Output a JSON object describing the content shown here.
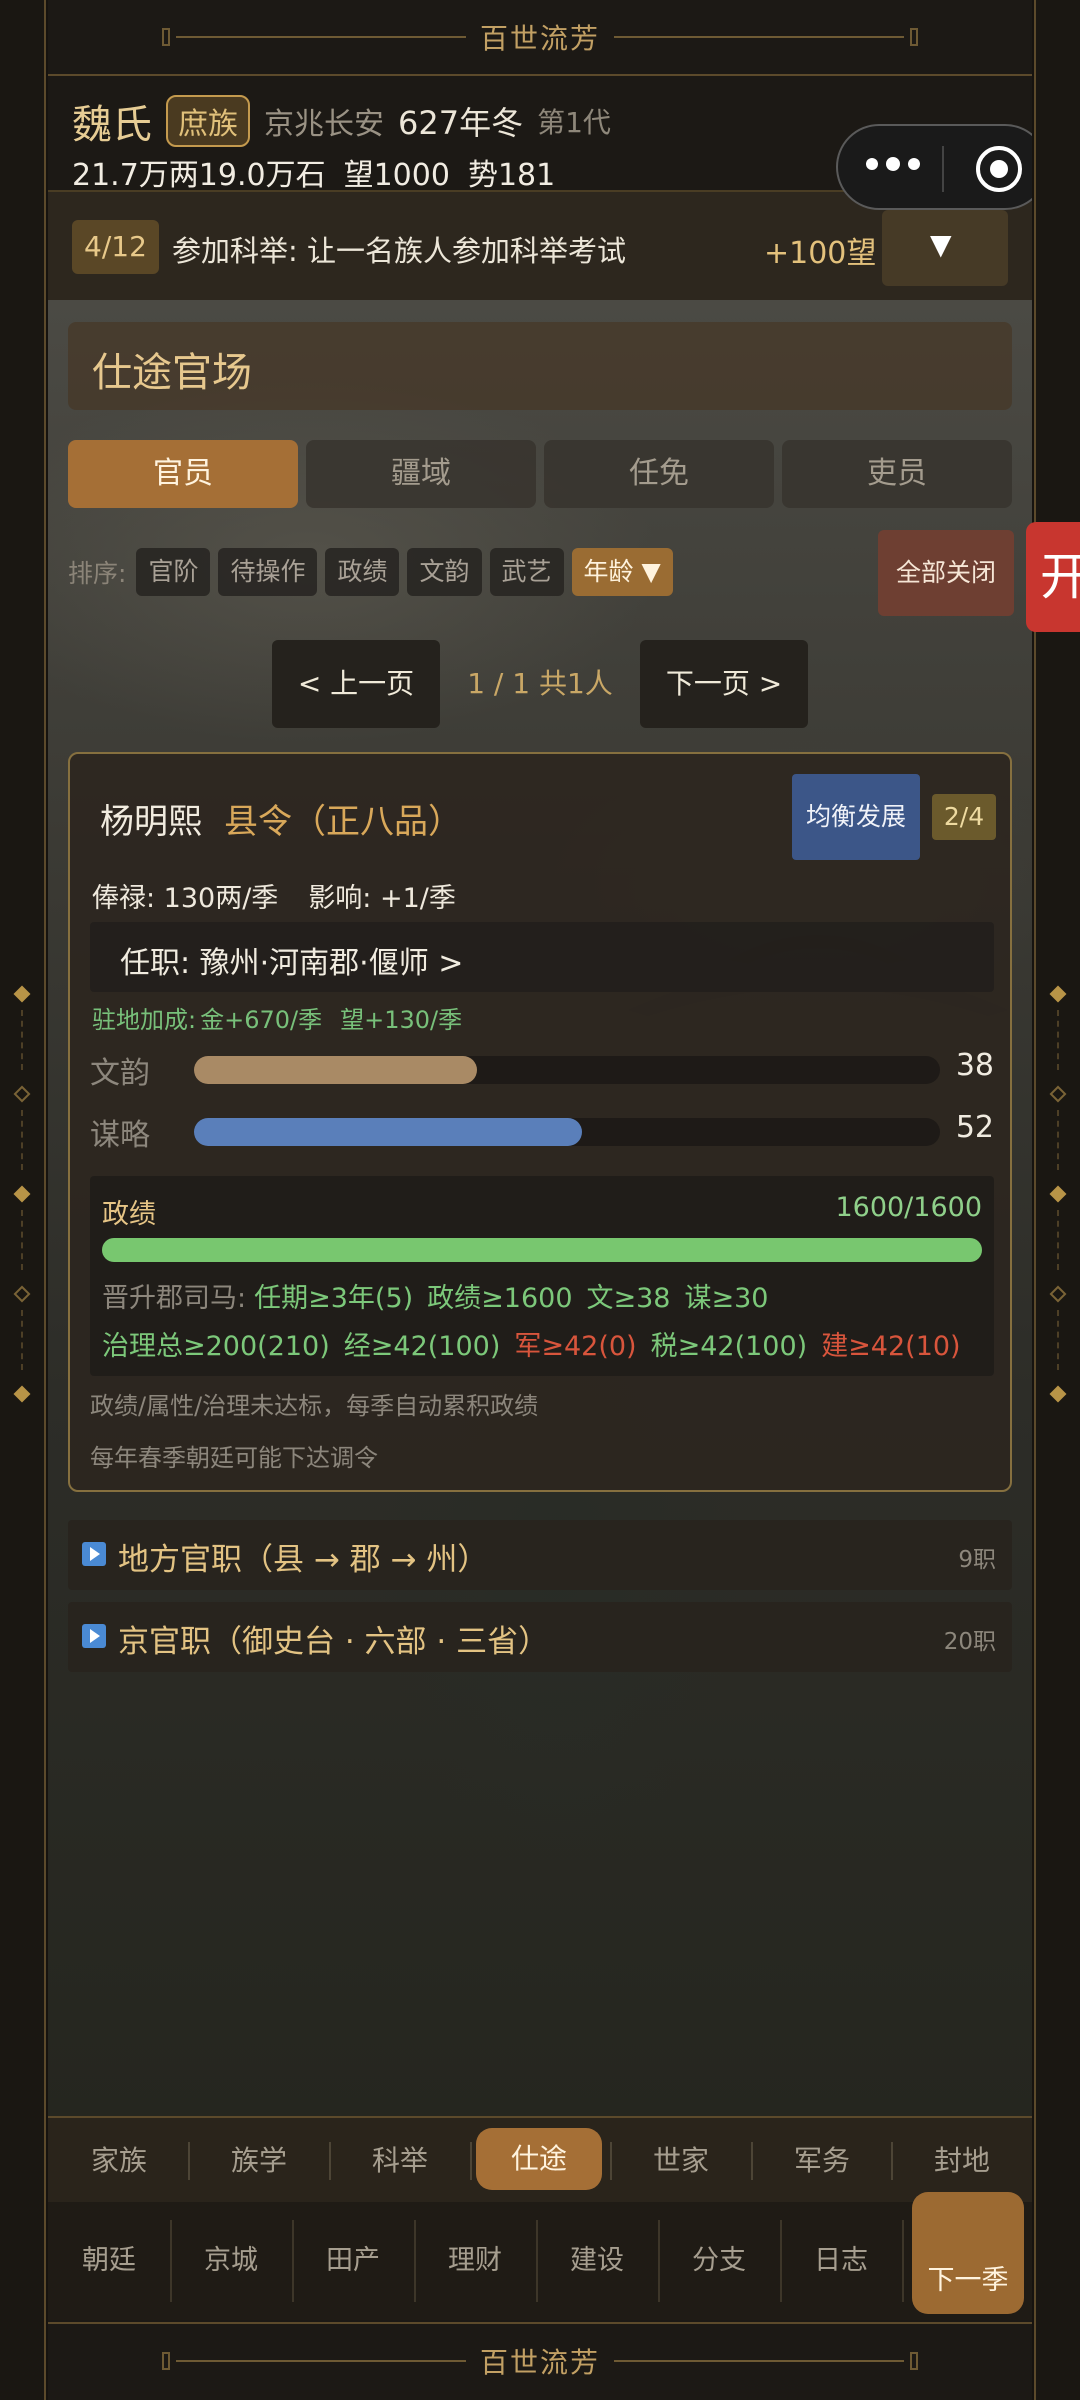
{
  "banner": {
    "title": "百世流芳"
  },
  "header": {
    "clan": "魏氏",
    "class_badge": "庶族",
    "location": "京兆长安",
    "year": "627年冬",
    "generation": "第1代",
    "stats": [
      "21.7万两19.0万石",
      "望1000",
      "势181"
    ]
  },
  "task": {
    "count": "4/12",
    "text": "参加科举: 让一名族人参加科举考试",
    "reward": "+100望",
    "dropdown": "▼"
  },
  "section_title": "仕途官场",
  "tabs": [
    "官员",
    "疆域",
    "任免",
    "吏员"
  ],
  "sort": {
    "label": "排序:",
    "options": [
      "官阶",
      "待操作",
      "政绩",
      "文韵",
      "武艺",
      "年龄 ▼"
    ],
    "selected": "年龄 ▼",
    "close_all": "全部关闭"
  },
  "side_tab": "开",
  "pager": {
    "prev": "< 上一页",
    "info": "1 / 1  共1人",
    "next": "下一页 >"
  },
  "official": {
    "name": "杨明熙",
    "rank": "县令（正八品）",
    "strategy_button": "均衡发展",
    "slot": "2/4",
    "salary": "俸禄: 130两/季",
    "influence": "影响: +1/季",
    "post": "任职: 豫州·河南郡·偃师  >",
    "bonus_label": "驻地加成:",
    "bonus_gold": "金+670/季",
    "bonus_prestige": "望+130/季",
    "attributes": [
      {
        "label": "文韵",
        "value": 38,
        "max": 100,
        "color": "#a98a65"
      },
      {
        "label": "谋略",
        "value": 52,
        "max": 100,
        "color": "#5a7fba"
      }
    ],
    "governance": {
      "label": "政绩",
      "value": "1600/1600",
      "progress": 1.0,
      "promotion_title": "晋升郡司马:",
      "promotion_reqs": [
        "任期≥3年(5)",
        "政绩≥1600",
        "文≥38",
        "谋≥30"
      ],
      "admin_reqs": [
        {
          "text": "治理总≥200(210)",
          "met": true
        },
        {
          "text": "经≥42(100)",
          "met": true
        },
        {
          "text": "军≥42(0)",
          "met": false
        },
        {
          "text": "税≥42(100)",
          "met": true
        },
        {
          "text": "建≥42(10)",
          "met": false
        }
      ]
    },
    "note1": "政绩/属性/治理未达标，每季自动累积政绩",
    "note2": "每年春季朝廷可能下达调令"
  },
  "lists": [
    {
      "title": "地方官职（县 → 郡 → 州）",
      "count": "9职"
    },
    {
      "title": "京官职（御史台 · 六部 · 三省）",
      "count": "20职"
    }
  ],
  "nav_primary": [
    "家族",
    "族学",
    "科举",
    "仕途",
    "世家",
    "军务",
    "封地"
  ],
  "nav_primary_active": "仕途",
  "nav_secondary": [
    "朝廷",
    "京城",
    "田产",
    "理财",
    "建设",
    "分支",
    "日志"
  ],
  "next_season": "下一季"
}
